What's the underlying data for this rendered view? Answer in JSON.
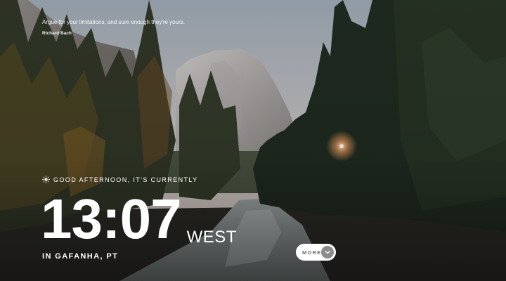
{
  "quote": {
    "text": "Argue for your limitations, and sure enough they're yours.",
    "author": "Richard Bach"
  },
  "greeting": {
    "icon": "sun-icon",
    "text": "GOOD AFTERNOON, IT'S CURRENTLY"
  },
  "clock": {
    "time": "13:07",
    "period": "WEST"
  },
  "location": "IN GAFANHA, PT",
  "more_button": {
    "label": "MORE",
    "icon": "chevron-down-icon"
  },
  "colors": {
    "text": "#ffffff",
    "button_bg": "#ffffff",
    "chevron_bg": "#8c8c8c"
  }
}
